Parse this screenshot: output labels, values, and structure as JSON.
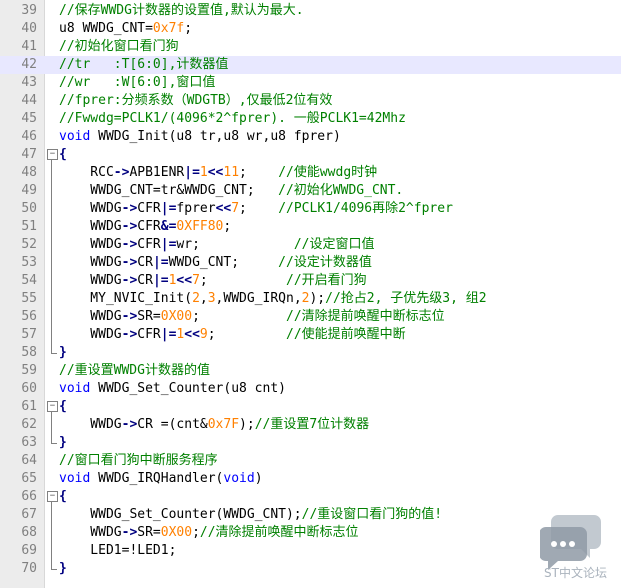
{
  "editor": {
    "highlight_line": 42,
    "lines": [
      {
        "n": "39",
        "t": [
          [
            "cm",
            "//保存WWDG计数器的设置值,默认为最大."
          ]
        ]
      },
      {
        "n": "40",
        "t": [
          [
            "",
            "u8 WWDG_CNT="
          ],
          [
            "num",
            "0x7f"
          ],
          [
            "",
            ";"
          ]
        ]
      },
      {
        "n": "41",
        "t": [
          [
            "cm",
            "//初始化窗口看门狗"
          ]
        ]
      },
      {
        "n": "42",
        "t": [
          [
            "cm",
            "//tr   :T[6:0],计数器值"
          ]
        ]
      },
      {
        "n": "43",
        "t": [
          [
            "cm",
            "//wr   :W[6:0],窗口值"
          ]
        ]
      },
      {
        "n": "44",
        "t": [
          [
            "cm",
            "//fprer:分频系数（WDGTB）,仅最低2位有效"
          ]
        ]
      },
      {
        "n": "45",
        "t": [
          [
            "cm",
            "//Fwwdg=PCLK1/(4096*2^fprer). 一般PCLK1=42Mhz"
          ]
        ]
      },
      {
        "n": "46",
        "t": [
          [
            "kw",
            "void"
          ],
          [
            "",
            " WWDG_Init(u8 tr,u8 wr,u8 fprer)"
          ]
        ]
      },
      {
        "n": "47",
        "t": [
          [
            "op",
            "{"
          ]
        ]
      },
      {
        "n": "48",
        "t": [
          [
            "",
            "    RCC"
          ],
          [
            "op",
            "->"
          ],
          [
            "",
            "APB1ENR"
          ],
          [
            "op",
            "|="
          ],
          [
            "num",
            "1"
          ],
          [
            "op",
            "<<"
          ],
          [
            "num",
            "11"
          ],
          [
            "",
            ";    "
          ],
          [
            "cm",
            "//使能wwdg时钟"
          ]
        ]
      },
      {
        "n": "49",
        "t": [
          [
            "",
            "    WWDG_CNT=tr&WWDG_CNT;   "
          ],
          [
            "cm",
            "//初始化WWDG_CNT."
          ]
        ]
      },
      {
        "n": "50",
        "t": [
          [
            "",
            "    WWDG"
          ],
          [
            "op",
            "->"
          ],
          [
            "",
            "CFR"
          ],
          [
            "op",
            "|="
          ],
          [
            "",
            "fprer"
          ],
          [
            "op",
            "<<"
          ],
          [
            "num",
            "7"
          ],
          [
            "",
            ";    "
          ],
          [
            "cm",
            "//PCLK1/4096再除2^fprer"
          ]
        ]
      },
      {
        "n": "51",
        "t": [
          [
            "",
            "    WWDG"
          ],
          [
            "op",
            "->"
          ],
          [
            "",
            "CFR"
          ],
          [
            "op",
            "&="
          ],
          [
            "num",
            "0XFF80"
          ],
          [
            "",
            ";"
          ]
        ]
      },
      {
        "n": "52",
        "t": [
          [
            "",
            "    WWDG"
          ],
          [
            "op",
            "->"
          ],
          [
            "",
            "CFR"
          ],
          [
            "op",
            "|="
          ],
          [
            "",
            "wr;            "
          ],
          [
            "cm",
            "//设定窗口值"
          ]
        ]
      },
      {
        "n": "53",
        "t": [
          [
            "",
            "    WWDG"
          ],
          [
            "op",
            "->"
          ],
          [
            "",
            "CR"
          ],
          [
            "op",
            "|="
          ],
          [
            "",
            "WWDG_CNT;     "
          ],
          [
            "cm",
            "//设定计数器值"
          ]
        ]
      },
      {
        "n": "54",
        "t": [
          [
            "",
            "    WWDG"
          ],
          [
            "op",
            "->"
          ],
          [
            "",
            "CR"
          ],
          [
            "op",
            "|="
          ],
          [
            "num",
            "1"
          ],
          [
            "op",
            "<<"
          ],
          [
            "num",
            "7"
          ],
          [
            "",
            ";          "
          ],
          [
            "cm",
            "//开启看门狗"
          ]
        ]
      },
      {
        "n": "55",
        "t": [
          [
            "",
            "    MY_NVIC_Init("
          ],
          [
            "num",
            "2"
          ],
          [
            "",
            ","
          ],
          [
            "num",
            "3"
          ],
          [
            "",
            ",WWDG_IRQn,"
          ],
          [
            "num",
            "2"
          ],
          [
            "",
            ");"
          ],
          [
            "cm",
            "//抢占2, 子优先级3, 组2"
          ]
        ]
      },
      {
        "n": "56",
        "t": [
          [
            "",
            "    WWDG"
          ],
          [
            "op",
            "->"
          ],
          [
            "",
            "SR="
          ],
          [
            "num",
            "0X00"
          ],
          [
            "",
            ";           "
          ],
          [
            "cm",
            "//清除提前唤醒中断标志位"
          ]
        ]
      },
      {
        "n": "57",
        "t": [
          [
            "",
            "    WWDG"
          ],
          [
            "op",
            "->"
          ],
          [
            "",
            "CFR"
          ],
          [
            "op",
            "|="
          ],
          [
            "num",
            "1"
          ],
          [
            "op",
            "<<"
          ],
          [
            "num",
            "9"
          ],
          [
            "",
            ";         "
          ],
          [
            "cm",
            "//使能提前唤醒中断"
          ]
        ]
      },
      {
        "n": "58",
        "t": [
          [
            "op",
            "}"
          ]
        ]
      },
      {
        "n": "59",
        "t": [
          [
            "cm",
            "//重设置WWDG计数器的值"
          ]
        ]
      },
      {
        "n": "60",
        "t": [
          [
            "kw",
            "void"
          ],
          [
            "",
            " WWDG_Set_Counter(u8 cnt)"
          ]
        ]
      },
      {
        "n": "61",
        "t": [
          [
            "op",
            "{"
          ]
        ]
      },
      {
        "n": "62",
        "t": [
          [
            "",
            "    WWDG"
          ],
          [
            "op",
            "->"
          ],
          [
            "",
            "CR ="
          ],
          [
            "",
            "(cnt&"
          ],
          [
            "num",
            "0x7F"
          ],
          [
            "",
            ");"
          ],
          [
            "cm",
            "//重设置7位计数器"
          ]
        ]
      },
      {
        "n": "63",
        "t": [
          [
            "op",
            "}"
          ]
        ]
      },
      {
        "n": "64",
        "t": [
          [
            "cm",
            "//窗口看门狗中断服务程序"
          ]
        ]
      },
      {
        "n": "65",
        "t": [
          [
            "kw",
            "void"
          ],
          [
            "",
            " WWDG_IRQHandler("
          ],
          [
            "kw",
            "void"
          ],
          [
            "",
            ")"
          ]
        ]
      },
      {
        "n": "66",
        "t": [
          [
            "op",
            "{"
          ]
        ]
      },
      {
        "n": "67",
        "t": [
          [
            "",
            "    WWDG_Set_Counter(WWDG_CNT);"
          ],
          [
            "cm",
            "//重设窗口看门狗的值!"
          ]
        ]
      },
      {
        "n": "68",
        "t": [
          [
            "",
            "    WWDG"
          ],
          [
            "op",
            "->"
          ],
          [
            "",
            "SR="
          ],
          [
            "num",
            "0X00"
          ],
          [
            "",
            ";"
          ],
          [
            "cm",
            "//清除提前唤醒中断标志位"
          ]
        ]
      },
      {
        "n": "69",
        "t": [
          [
            "",
            "    LED1=!LED1;"
          ]
        ]
      },
      {
        "n": "70",
        "t": [
          [
            "op",
            "}"
          ]
        ]
      }
    ]
  },
  "watermark": {
    "text": "ST中文论坛",
    "icon": "chat-bubbles-icon"
  }
}
